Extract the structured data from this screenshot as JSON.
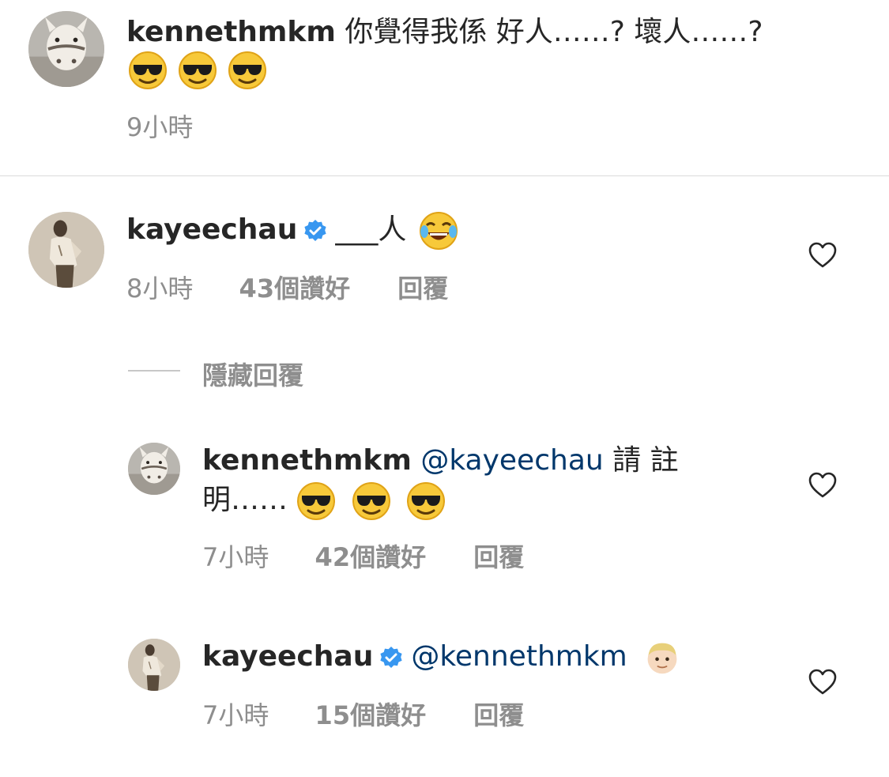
{
  "comments": [
    {
      "username": "kennethmkm",
      "text": "你覺得我係 好人……? 壞人……?",
      "emoji": [
        "sunglasses-face",
        "sunglasses-face",
        "sunglasses-face"
      ],
      "time": "9小時"
    },
    {
      "username": "kayeechau",
      "verified": true,
      "text": "___人",
      "emoji": [
        "tears-of-joy-face"
      ],
      "time": "8小時",
      "likes": "43個讚好",
      "reply_label": "回覆"
    }
  ],
  "hide_replies_label": "隱藏回覆",
  "replies": [
    {
      "username": "kennethmkm",
      "mention": "@kayeechau",
      "text_line1": "請 註",
      "text_line2": "明……",
      "emoji": [
        "sunglasses-face",
        "sunglasses-face",
        "sunglasses-face"
      ],
      "time": "7小時",
      "likes": "42個讚好",
      "reply_label": "回覆"
    },
    {
      "username": "kayeechau",
      "verified": true,
      "mention": "@kennethmkm",
      "emoji": [
        "blond-person-face"
      ],
      "time": "7小時",
      "likes": "15個讚好",
      "reply_label": "回覆"
    }
  ],
  "colors": {
    "text": "#262626",
    "secondary": "#8e8e8e",
    "mention": "#00376b",
    "verified": "#3897f0",
    "divider": "#dbdbdb"
  }
}
